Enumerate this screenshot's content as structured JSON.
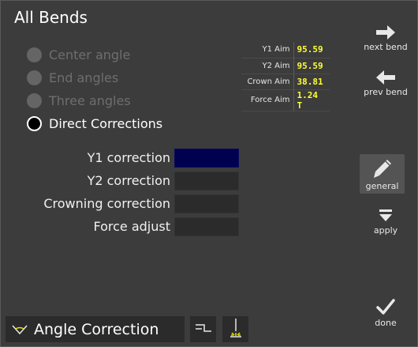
{
  "title": "All Bends",
  "modes": [
    {
      "label": "Center angle",
      "selected": false
    },
    {
      "label": "End angles",
      "selected": false
    },
    {
      "label": "Three angles",
      "selected": false
    },
    {
      "label": "Direct Corrections",
      "selected": true
    }
  ],
  "aims": [
    {
      "label": "Y1 Aim",
      "value": "95.59"
    },
    {
      "label": "Y2 Aim",
      "value": "95.59"
    },
    {
      "label": "Crown Aim",
      "value": "38.81"
    },
    {
      "label": "Force Aim",
      "value": "1.24 T"
    }
  ],
  "corrections": [
    {
      "label": "Y1 correction",
      "value": ""
    },
    {
      "label": "Y2 correction",
      "value": ""
    },
    {
      "label": "Crowning correction",
      "value": ""
    },
    {
      "label": "Force adjust",
      "value": ""
    }
  ],
  "side_buttons": {
    "next_bend": "next bend",
    "prev_bend": "prev bend",
    "general": "general",
    "apply": "apply",
    "done": "done"
  },
  "bottom": {
    "angle_correction": "Angle Correction"
  },
  "icons": {
    "next": "arrow-right-icon",
    "prev": "arrow-left-icon",
    "general": "pencil-icon",
    "apply": "apply-icon",
    "done": "checkmark-icon",
    "angle": "angle-triangle-icon",
    "step": "step-profile-icon",
    "punch": "punch-light-icon"
  },
  "colors": {
    "background": "#3c3c3c",
    "field": "#2b2b2b",
    "active_field": "#000050",
    "aim_value": "#ffff33",
    "disabled_text": "#6e6e6e"
  }
}
